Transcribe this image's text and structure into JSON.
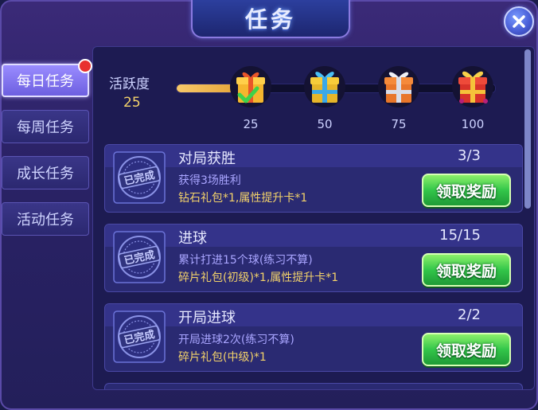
{
  "title": "任务",
  "close_icon": "close-icon",
  "sidebar": {
    "items": [
      {
        "label": "每日任务",
        "active": true,
        "has_dot": true
      },
      {
        "label": "每周任务",
        "active": false
      },
      {
        "label": "成长任务",
        "active": false
      },
      {
        "label": "活动任务",
        "active": false
      }
    ]
  },
  "activity": {
    "label": "活跃度",
    "value": "25",
    "progress_fraction": 0.25,
    "milestones": [
      {
        "value": "25",
        "icon": "gift-box-open-icon",
        "claimed": true
      },
      {
        "value": "50",
        "icon": "gift-box-blue-icon",
        "claimed": false
      },
      {
        "value": "75",
        "icon": "gift-box-orange-icon",
        "claimed": false
      },
      {
        "value": "100",
        "icon": "gift-box-red-icon",
        "claimed": false
      }
    ]
  },
  "tasks": [
    {
      "name": "对局获胜",
      "count": "3/3",
      "desc": "获得3场胜利",
      "reward": "钻石礼包*1,属性提升卡*1",
      "badge": "已完成",
      "button": "领取奖励"
    },
    {
      "name": "进球",
      "count": "15/15",
      "desc": "累计打进15个球(练习不算)",
      "reward": "碎片礼包(初级)*1,属性提升卡*1",
      "badge": "已完成",
      "button": "领取奖励"
    },
    {
      "name": "开局进球",
      "count": "2/2",
      "desc": "开局进球2次(练习不算)",
      "reward": "碎片礼包(中级)*1",
      "badge": "已完成",
      "button": "领取奖励"
    }
  ],
  "colors": {
    "accent_gold": "#f3d26a",
    "claim_green": "#33c64a",
    "desc_purple": "#a9a5ff"
  }
}
